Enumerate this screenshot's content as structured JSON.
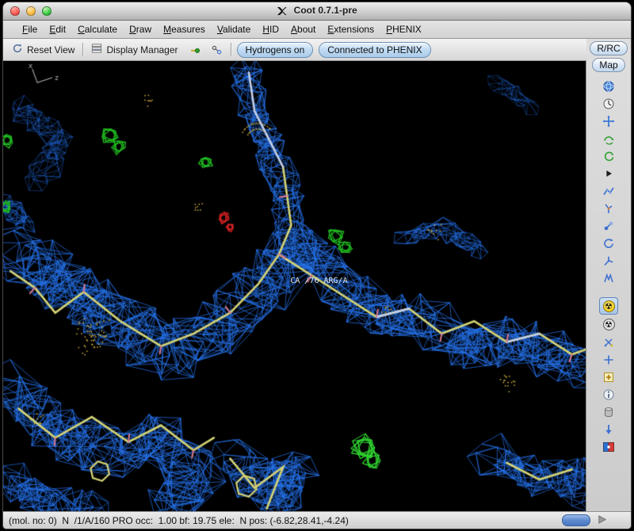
{
  "window": {
    "title": "Coot 0.7.1-pre"
  },
  "menubar": {
    "items": [
      {
        "id": "menu-file",
        "label": "File"
      },
      {
        "id": "menu-edit",
        "label": "Edit"
      },
      {
        "id": "menu-calculate",
        "label": "Calculate"
      },
      {
        "id": "menu-draw",
        "label": "Draw"
      },
      {
        "id": "menu-measures",
        "label": "Measures"
      },
      {
        "id": "menu-validate",
        "label": "Validate"
      },
      {
        "id": "menu-hid",
        "label": "HID"
      },
      {
        "id": "menu-about",
        "label": "About"
      },
      {
        "id": "menu-extensions",
        "label": "Extensions"
      },
      {
        "id": "menu-phenix",
        "label": "PHENIX"
      }
    ]
  },
  "toolbar": {
    "reset_view": "Reset View",
    "display_manager": "Display Manager",
    "hydrogens_toggle": "Hydrogens on",
    "phenix_status": "Connected to PHENIX"
  },
  "side_buttons": {
    "rrc": "R/RC",
    "map": "Map"
  },
  "right_toolbar": {
    "icon_names": [
      "globe-icon",
      "timer-icon",
      "move-axes-icon",
      "rotate-zone-icon",
      "recycle-icon",
      "expander-icon",
      "backbone-icon",
      "chi-angles-icon",
      "torsion-icon",
      "rotate-translate-icon",
      "side-chain-icon",
      "mutate-icon",
      "radiation-active-icon",
      "radiation-icon",
      "add-terminal-icon",
      "add-alt-conf-icon",
      "add-atom-icon",
      "info-icon",
      "delete-item-icon",
      "down-arrow-icon",
      "flag-icon"
    ]
  },
  "scene": {
    "atom_label": "CA /76 ARG/A",
    "axis": {
      "x": "x",
      "z": "z"
    },
    "colors": {
      "background": "#000000",
      "mesh_blue": "#2470e8",
      "density_green": "#22c522",
      "density_green_bright": "#33e033",
      "density_red": "#d42222",
      "stick_yellow": "#d2d276",
      "stick_light": "#c3cfe8",
      "stub_pink": "#d87890",
      "dot_yellow": "#c9a93c",
      "label_white": "#e6e6e6",
      "axis_gray": "#aeb8ae"
    }
  },
  "statusbar": {
    "text": "(mol. no: 0)  N  /1/A/160 PRO occ:  1.00 bf: 19.75 ele:  N pos: (-6.82,28.41,-4.24)"
  }
}
